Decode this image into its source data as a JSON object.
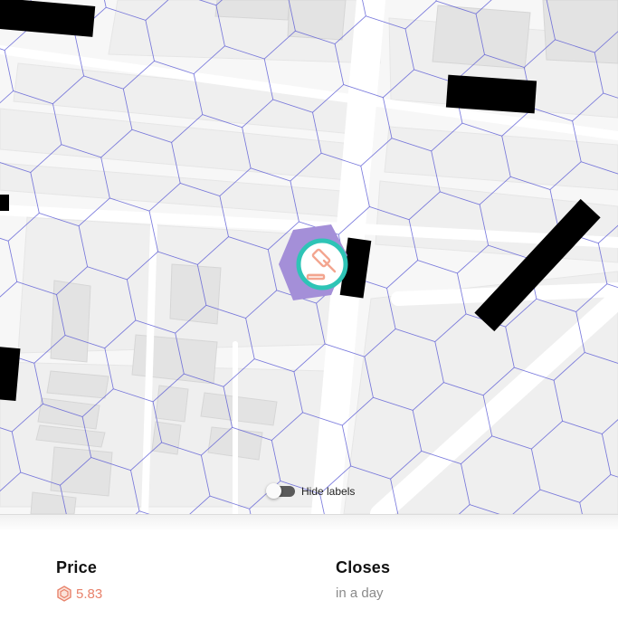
{
  "map": {
    "toggle_label": "Hide labels",
    "toggle_on": false,
    "colors": {
      "background": "#f7f7f7",
      "block": "#eeeeee",
      "building": "#e4e4e4",
      "road": "#ffffff",
      "hex_grid": "#5b5bd6",
      "marker_hex": "#a48fd8",
      "marker_ring": "#2ec4b6",
      "marker_icon": "#f3a58f",
      "redaction": "#000000"
    },
    "marker_icon": "gavel-icon"
  },
  "details": {
    "price_label": "Price",
    "price_value": "5.83",
    "price_icon": "hex-coin-icon",
    "closes_label": "Closes",
    "closes_value": "in a day",
    "accent": "#e8826b"
  }
}
